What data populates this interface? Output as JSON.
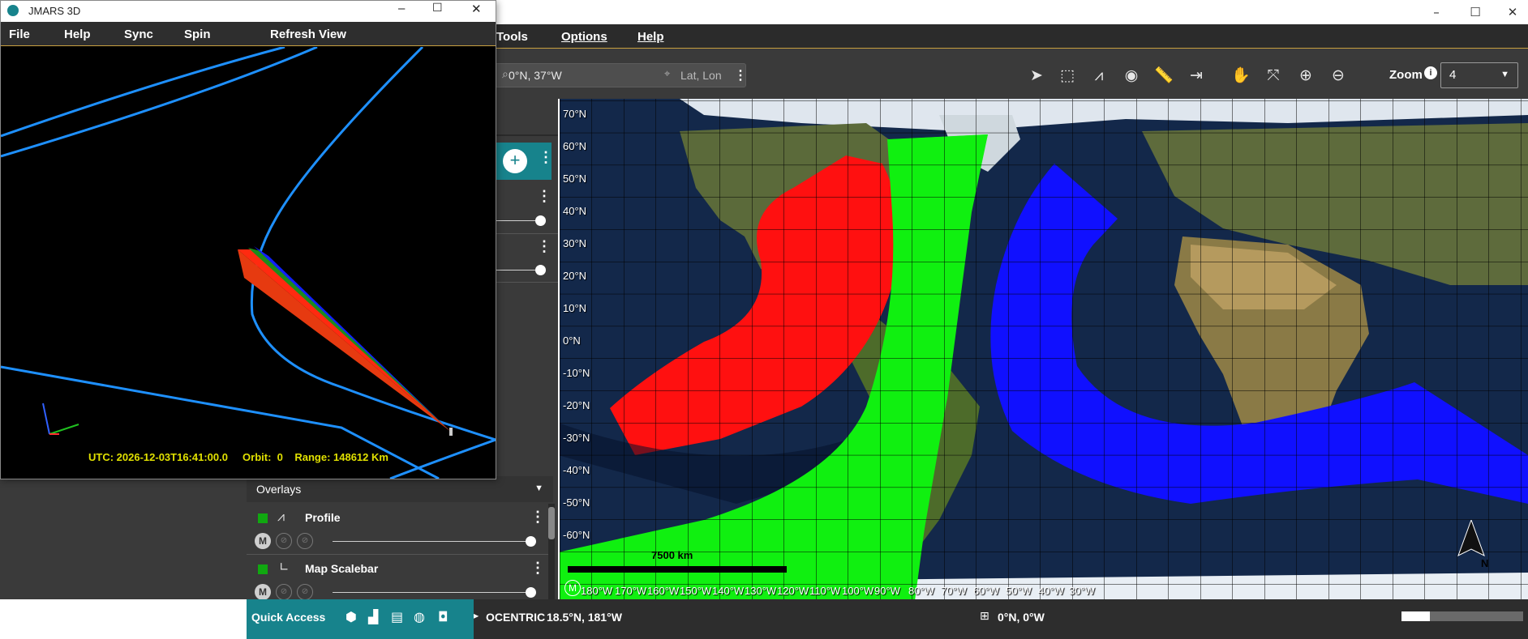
{
  "main_window": {
    "menu": {
      "tools": "Tools",
      "options": "Options",
      "help": "Help"
    },
    "search": {
      "value": "0°N, 37°W",
      "coord_mode": "Lat, Lon"
    },
    "zoom": {
      "label": "Zoom",
      "value": "4"
    }
  },
  "map": {
    "lat_labels": [
      "70°N",
      "60°N",
      "50°N",
      "40°N",
      "30°N",
      "20°N",
      "10°N",
      "0°N",
      "-10°N",
      "-20°N",
      "-30°N",
      "-40°N",
      "-50°N",
      "-60°N"
    ],
    "lon_labels": [
      "180°W",
      "170°W",
      "160°W",
      "150°W",
      "140°W",
      "130°W",
      "120°W",
      "110°W",
      "100°W",
      "90°W",
      "80°W",
      "70°W",
      "60°W",
      "50°W",
      "40°W",
      "30°W"
    ],
    "scalebar": "7500 km",
    "north_label": "N",
    "footprint_colors": {
      "red": "#ff1010",
      "green": "#10f010",
      "blue": "#1010ff"
    }
  },
  "layers": {
    "overlays_header": "Overlays",
    "items": [
      {
        "name": "Profile"
      },
      {
        "name": "Map Scalebar"
      }
    ],
    "m_button": "M"
  },
  "status": {
    "quick_access": "Quick Access",
    "projection": "OCENTRIC",
    "cursor_coords": "18.5°N, 181°W",
    "center_coords": "0°N, 0°W"
  },
  "win3d": {
    "title": "JMARS 3D",
    "menu": {
      "file": "File",
      "help": "Help",
      "sync": "Sync",
      "spin": "Spin",
      "refresh": "Refresh View"
    },
    "utc": "UTC: 2026-12-03T16:41:00.0",
    "orbit": "Orbit:  0",
    "range": "Range: 148612 Km"
  }
}
